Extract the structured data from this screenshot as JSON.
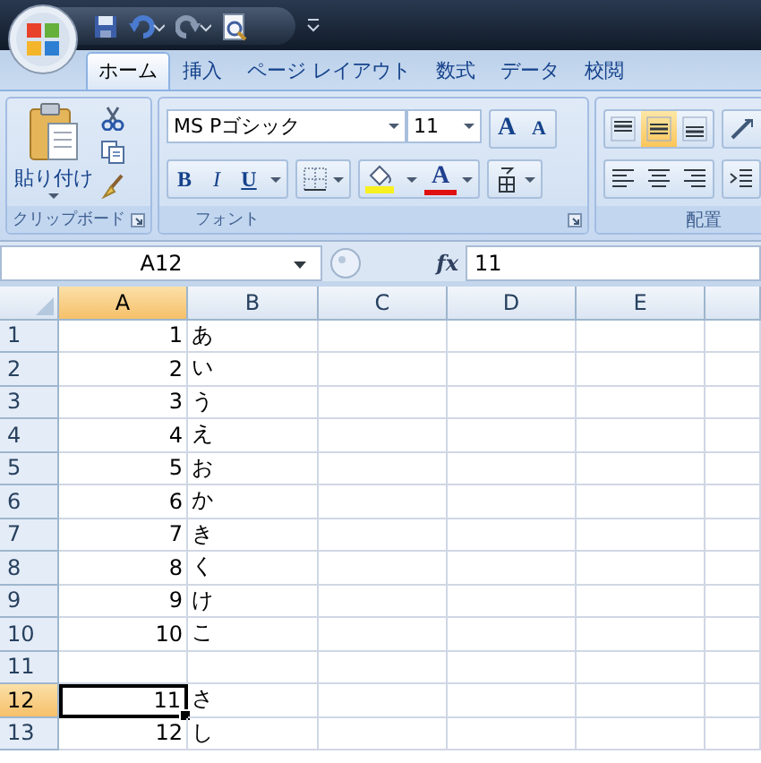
{
  "ribbon_tabs": [
    {
      "label": "ホーム",
      "selected": true
    },
    {
      "label": "挿入",
      "selected": false
    },
    {
      "label": "ページ レイアウト",
      "selected": false
    },
    {
      "label": "数式",
      "selected": false
    },
    {
      "label": "データ",
      "selected": false
    },
    {
      "label": "校閲",
      "selected": false
    }
  ],
  "clipboard_group": {
    "paste_label": "貼り付け",
    "label": "クリップボード"
  },
  "font_group": {
    "font_name": "MS Pゴシック",
    "font_size": "11",
    "style_buttons": [
      "B",
      "I",
      "U"
    ],
    "grow_label": "A",
    "shrink_label": "A",
    "font_color_label": "A",
    "label": "フォント"
  },
  "alignment_group": {
    "vertical_buttons": [
      {
        "kind": "top",
        "selected": false
      },
      {
        "kind": "middle",
        "selected": true
      },
      {
        "kind": "bottom",
        "selected": false
      }
    ],
    "horizontal_buttons": [
      {
        "kind": "left",
        "selected": false
      },
      {
        "kind": "center",
        "selected": false
      },
      {
        "kind": "right",
        "selected": false
      }
    ],
    "label": "配置"
  },
  "formula_bar": {
    "name_box": "A12",
    "fx_label": "fx",
    "value": "11"
  },
  "sheet": {
    "columns": [
      {
        "label": "A",
        "selected": true
      },
      {
        "label": "B",
        "selected": false
      },
      {
        "label": "C",
        "selected": false
      },
      {
        "label": "D",
        "selected": false
      },
      {
        "label": "E",
        "selected": false
      }
    ],
    "rows": [
      {
        "header": "1",
        "selected": false,
        "cells": [
          {
            "text": "1",
            "active": false
          },
          {
            "text": "あ",
            "active": false
          }
        ]
      },
      {
        "header": "2",
        "selected": false,
        "cells": [
          {
            "text": "2",
            "active": false
          },
          {
            "text": "い",
            "active": false
          }
        ]
      },
      {
        "header": "3",
        "selected": false,
        "cells": [
          {
            "text": "3",
            "active": false
          },
          {
            "text": "う",
            "active": false
          }
        ]
      },
      {
        "header": "4",
        "selected": false,
        "cells": [
          {
            "text": "4",
            "active": false
          },
          {
            "text": "え",
            "active": false
          }
        ]
      },
      {
        "header": "5",
        "selected": false,
        "cells": [
          {
            "text": "5",
            "active": false
          },
          {
            "text": "お",
            "active": false
          }
        ]
      },
      {
        "header": "6",
        "selected": false,
        "cells": [
          {
            "text": "6",
            "active": false
          },
          {
            "text": "か",
            "active": false
          }
        ]
      },
      {
        "header": "7",
        "selected": false,
        "cells": [
          {
            "text": "7",
            "active": false
          },
          {
            "text": "き",
            "active": false
          }
        ]
      },
      {
        "header": "8",
        "selected": false,
        "cells": [
          {
            "text": "8",
            "active": false
          },
          {
            "text": "く",
            "active": false
          }
        ]
      },
      {
        "header": "9",
        "selected": false,
        "cells": [
          {
            "text": "9",
            "active": false
          },
          {
            "text": "け",
            "active": false
          }
        ]
      },
      {
        "header": "10",
        "selected": false,
        "cells": [
          {
            "text": "10",
            "active": false
          },
          {
            "text": "こ",
            "active": false
          }
        ]
      },
      {
        "header": "11",
        "selected": false,
        "cells": []
      },
      {
        "header": "12",
        "selected": true,
        "cells": [
          {
            "text": "11",
            "active": true
          },
          {
            "text": "さ",
            "active": false
          }
        ]
      },
      {
        "header": "13",
        "selected": false,
        "cells": [
          {
            "text": "12",
            "active": false
          },
          {
            "text": "し",
            "active": false
          }
        ]
      }
    ]
  }
}
